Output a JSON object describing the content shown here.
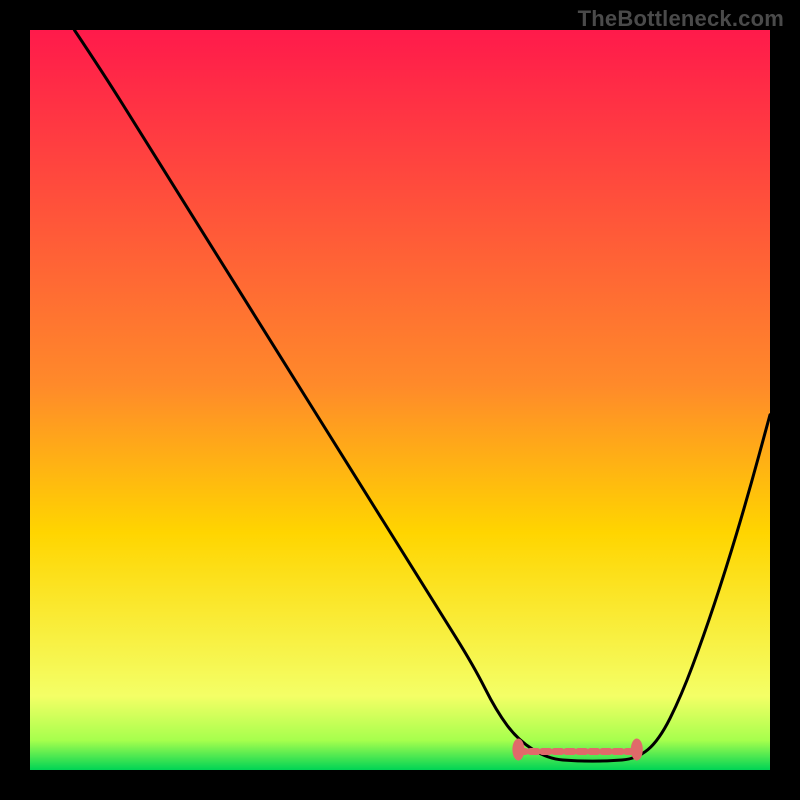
{
  "watermark": "TheBottleneck.com",
  "chart_data": {
    "type": "line",
    "title": "",
    "xlabel": "",
    "ylabel": "",
    "xlim": [
      0,
      100
    ],
    "ylim": [
      0,
      100
    ],
    "grid": false,
    "background_gradient": {
      "top": "#ff1a4b",
      "mid": "#ffd500",
      "bottom_band": "#a6ff4d",
      "base": "#00d455"
    },
    "series": [
      {
        "name": "bottleneck-curve",
        "color": "#000000",
        "x": [
          6,
          10,
          15,
          20,
          25,
          30,
          35,
          40,
          45,
          50,
          55,
          60,
          63,
          66,
          70,
          74,
          78,
          82,
          85,
          88,
          91,
          94,
          97,
          100
        ],
        "values": [
          100,
          94,
          86,
          78,
          70,
          62,
          54,
          46,
          38,
          30,
          22,
          14,
          8,
          4,
          1.5,
          1.2,
          1.2,
          1.5,
          4,
          10,
          18,
          27,
          37,
          48
        ]
      }
    ],
    "annotations": [
      {
        "name": "flat-bottom-marker",
        "kind": "segment",
        "color": "#e06a6a",
        "x": [
          66,
          82
        ],
        "y": [
          2.5,
          2.5
        ],
        "endcaps": true
      }
    ]
  }
}
